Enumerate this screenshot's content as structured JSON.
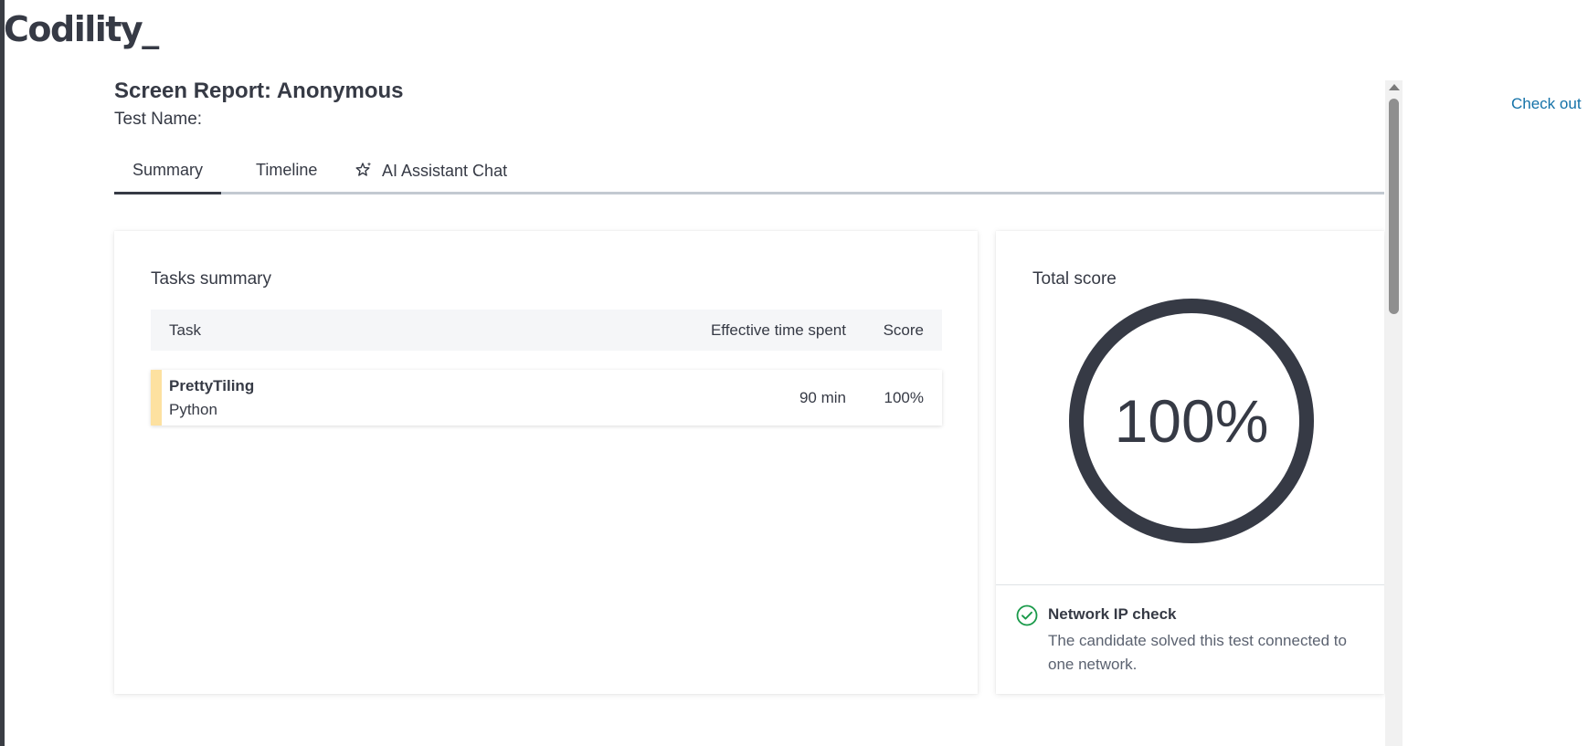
{
  "brand": {
    "logo_text": "Codility_"
  },
  "header": {
    "title": "Screen Report: Anonymous",
    "test_name_label": "Test Name:",
    "side_link": "Check out"
  },
  "tabs": [
    {
      "label": "Summary",
      "active": true
    },
    {
      "label": "Timeline",
      "active": false
    },
    {
      "label": "AI Assistant Chat",
      "active": false,
      "icon": "sparkle-star-icon"
    }
  ],
  "tasks_summary": {
    "title": "Tasks summary",
    "columns": {
      "task": "Task",
      "time": "Effective time spent",
      "score": "Score"
    },
    "rows": [
      {
        "name": "PrettyTiling",
        "language": "Python",
        "time": "90 min",
        "score": "100%",
        "accent_color": "#fde1a0"
      }
    ]
  },
  "total_score": {
    "title": "Total score",
    "value": "100%",
    "ring_fraction": 1.0,
    "ring_color": "#363a45"
  },
  "network_check": {
    "icon": "check-circle-icon",
    "title": "Network IP check",
    "description": "The candidate solved this test connected to one network.",
    "status_color": "#1a9a4a"
  },
  "colors": {
    "link": "#1472a8",
    "text": "#363a45"
  }
}
